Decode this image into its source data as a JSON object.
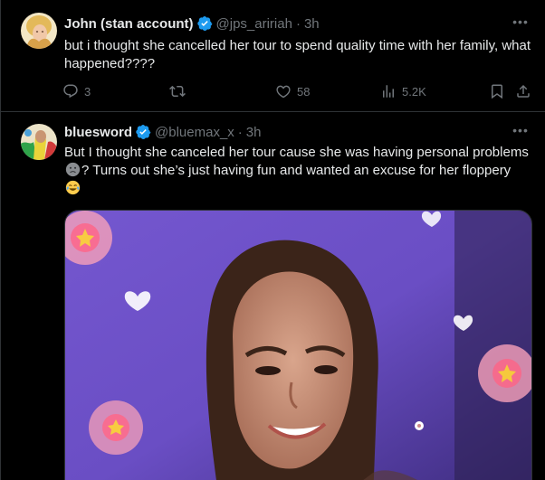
{
  "tweets": [
    {
      "name": "John (stan account)",
      "handle": "@jps_aririah",
      "time": "3h",
      "text": "but i thought she cancelled her tour to spend quality time with her family, what happened????",
      "replies": "3",
      "likes": "58",
      "views": "5.2K",
      "icons": [
        "reply-icon",
        "retweet-icon",
        "heart-icon",
        "views-icon",
        "bookmark-icon",
        "share-icon"
      ]
    },
    {
      "name": "bluesword",
      "handle": "@bluemax_x",
      "time": "3h",
      "text_part1": "But I thought she canceled her tour cause she was having personal problems",
      "text_part2": "? Turns out she’s just having fun and wanted an excuse for her floppery",
      "emoji_1": "slightly-frowning-face-emoji",
      "emoji_2": "face-with-tears-of-joy-emoji"
    }
  ],
  "colors": {
    "background": "#000000",
    "text": "#e7e9ea",
    "muted": "#71767b",
    "verified": "#1d9bf0",
    "divider": "#2f3336",
    "media_bg": "#6f4fc2"
  }
}
